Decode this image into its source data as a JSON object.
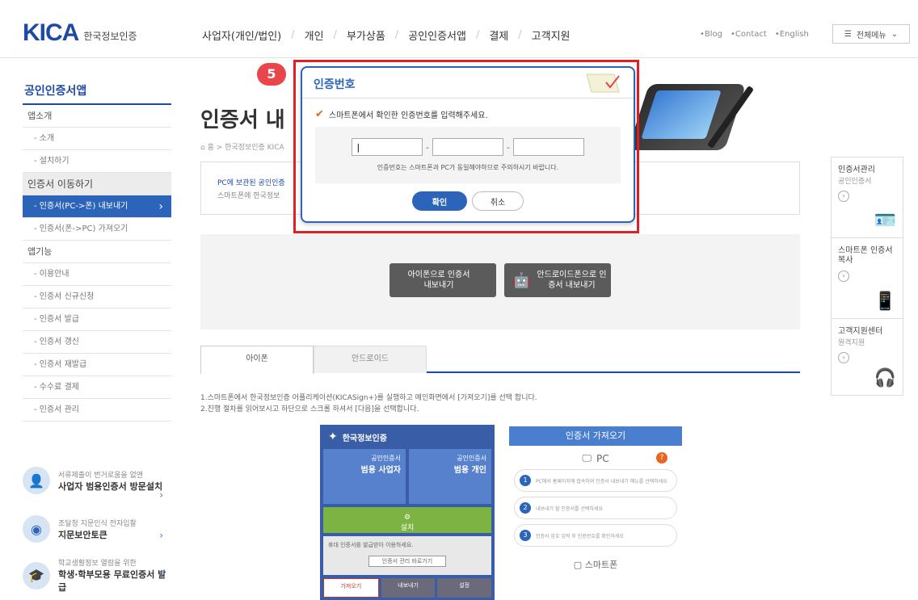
{
  "header": {
    "logo_mark": "KICA",
    "logo_text": "한국정보인증",
    "nav": [
      "사업자(개인/법인)",
      "개인",
      "부가상품",
      "공인인증서앱",
      "결제",
      "고객지원"
    ],
    "util": [
      "•Blog",
      "•Contact",
      "•English"
    ],
    "allmenu": "전체메뉴"
  },
  "sidebar": {
    "title": "공인인증서앱",
    "items": [
      {
        "label": "앱소개",
        "type": "sec"
      },
      {
        "label": "- 소개",
        "type": "item"
      },
      {
        "label": "- 설치하기",
        "type": "item"
      },
      {
        "label": "인증서 이동하기",
        "type": "sec-active"
      },
      {
        "label": "- 인증서(PC->폰) 내보내기",
        "type": "active"
      },
      {
        "label": "- 인증서(폰->PC) 가져오기",
        "type": "item"
      },
      {
        "label": "앱기능",
        "type": "sec"
      },
      {
        "label": "- 이용안내",
        "type": "item"
      },
      {
        "label": "- 인증서 신규신청",
        "type": "item"
      },
      {
        "label": "- 인증서 발급",
        "type": "item"
      },
      {
        "label": "- 인증서 갱신",
        "type": "item"
      },
      {
        "label": "- 인증서 재발급",
        "type": "item"
      },
      {
        "label": "- 수수료 결제",
        "type": "item"
      },
      {
        "label": "- 인증서 관리",
        "type": "item"
      }
    ],
    "promos": [
      {
        "sub": "서류제출이 번거로움을 없앤",
        "main": "사업자 범용인증서 방문설치"
      },
      {
        "sub": "조달청 지문인식 전자입찰",
        "main": "지문보안토큰"
      },
      {
        "sub": "학교생활정보 열람을 위한",
        "main": "학생·학부모용 무료인증서 발급"
      }
    ]
  },
  "main": {
    "title": "인증서 내",
    "breadcrumb": "⌂ 홈 > 한국정보인증 KICA",
    "info_line1": "PC에 보관된 공인인증",
    "info_line2": "스마트폰에 한국정보",
    "store_buttons": [
      "아이폰으로 인증서 내보내기",
      "안드로이드폰으로 인증서 내보내기"
    ],
    "tabs": [
      "아이폰",
      "안드로이드"
    ],
    "desc": [
      "1.스마트폰에서 한국정보인증 어플리케이션(KICASign+)를 실행하고 메인화면에서 [가져오기]를 선택 합니다.",
      "2.진행 절차를 읽어보시고 하단으로 스크롤 하셔서 [다음]을 선택합니다."
    ]
  },
  "phone_mock": {
    "brand": "한국정보인증",
    "tile1_sub": "공인인증서",
    "tile1_main": "범용 사업자",
    "tile2_sub": "공인인증서",
    "tile2_main": "범용 개인",
    "green": "설치",
    "gray_text": "휴대 인증서를 발급받아 이용하세요.",
    "gray_btn": "인증서 관리 바로가기",
    "bottom": [
      "가져오기",
      "내보내기",
      "설정"
    ]
  },
  "steps_panel": {
    "title": "인증서 가져오기",
    "pc_label": "PC",
    "q": "?",
    "steps": [
      {
        "n": "1",
        "text": "PC에서 홈페이지에 접속하여 인증서 내보내기 메뉴를 선택하세요"
      },
      {
        "n": "2",
        "text": "내보내기 할 인증서를 선택하세요"
      },
      {
        "n": "3",
        "text": "인증서 암호 입력 후 인증번호를 확인하세요"
      }
    ],
    "smartphone_label": "스마트폰"
  },
  "quick_menu": [
    {
      "title": "인증서관리",
      "sub": "공인인증서"
    },
    {
      "title": "스마트폰 인증서 복사",
      "sub": ""
    },
    {
      "title": "고객지원센터",
      "sub": "원격지원"
    }
  ],
  "modal": {
    "badge": "5",
    "title": "인증번호",
    "guide": "스마트폰에서 확인한 인증번호를 입력해주세요.",
    "note": "인증번호는 스마트폰과 PC가 동일해야하므로 주의하시기 바랍니다.",
    "ok": "확인",
    "cancel": "취소"
  },
  "colors": {
    "brand_blue": "#2b64b9",
    "highlight_red": "#e31e24",
    "accent_orange": "#e8661d"
  }
}
